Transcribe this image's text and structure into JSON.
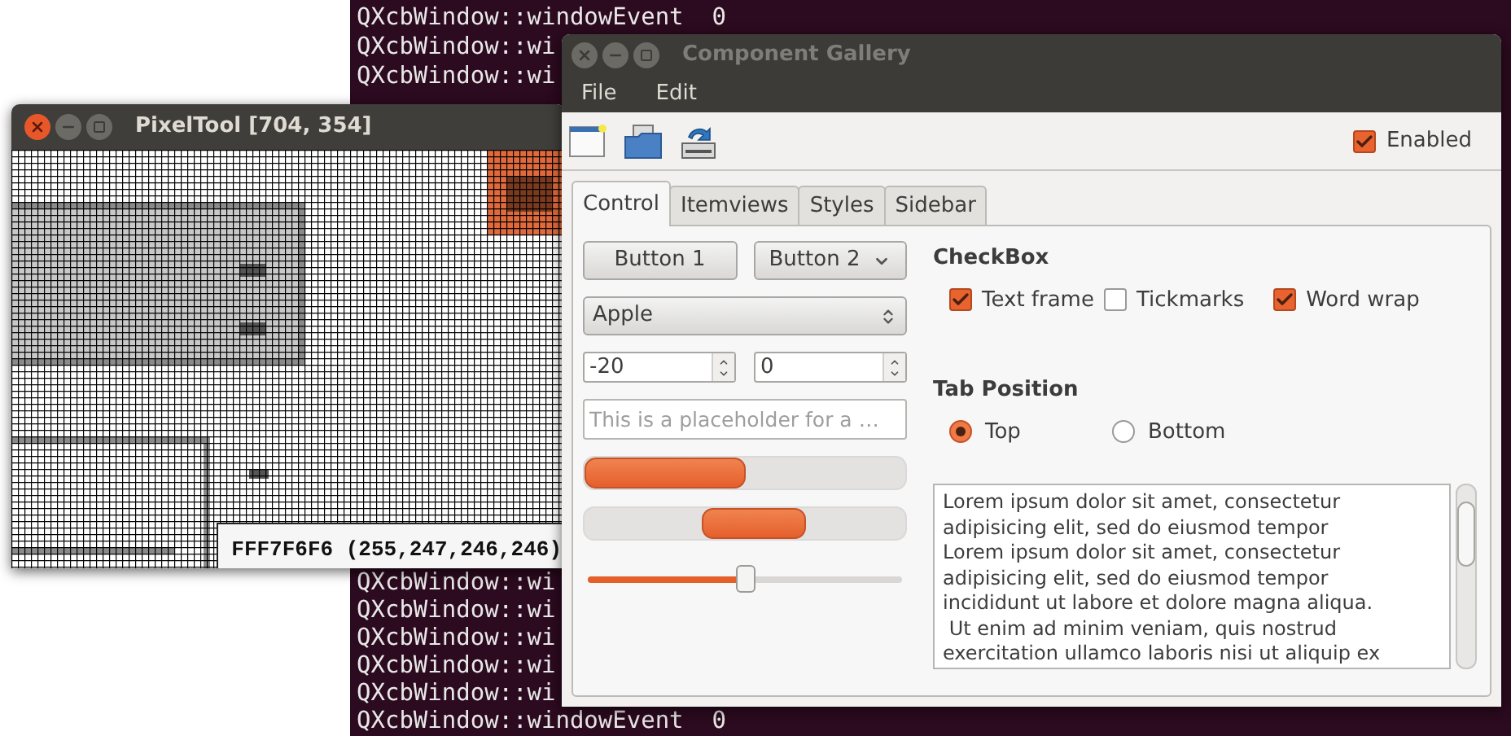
{
  "terminal": {
    "top_lines": [
      "QXcbWindow::windowEvent  0",
      "QXcbWindow::wi",
      "QXcbWindow::wi"
    ],
    "bottom_lines": [
      "QXcbWindow::wi",
      "QXcbWindow::wi",
      "QXcbWindow::wi",
      "QXcbWindow::wi",
      "QXcbWindow::wi",
      "QXcbWindow::windowEvent  0"
    ]
  },
  "pixel_tool": {
    "title": "PixelTool [704, 354]",
    "readout": "FFF7F6F6 (255,247,246,246)"
  },
  "gallery": {
    "title": "Component Gallery",
    "menu": [
      "File",
      "Edit"
    ],
    "enabled": {
      "label": "Enabled",
      "checked": true
    },
    "tabs": [
      {
        "label": "Control",
        "selected": true
      },
      {
        "label": "Itemviews",
        "selected": false
      },
      {
        "label": "Styles",
        "selected": false
      },
      {
        "label": "Sidebar",
        "selected": false
      }
    ],
    "buttons": [
      {
        "label": "Button 1",
        "kind": "plain"
      },
      {
        "label": "Button 2",
        "kind": "menu"
      }
    ],
    "combo": {
      "value": "Apple"
    },
    "spinboxes": [
      {
        "value": "-20"
      },
      {
        "value": "0"
      }
    ],
    "line_edit": {
      "placeholder": "This is a placeholder for a …"
    },
    "progress": {
      "level": 0.5
    },
    "slider": {
      "level": 0.5
    },
    "checkbox_group": {
      "title": "CheckBox",
      "items": [
        {
          "label": "Text frame",
          "checked": true
        },
        {
          "label": "Tickmarks",
          "checked": false
        },
        {
          "label": "Word wrap",
          "checked": true
        }
      ]
    },
    "radio_group": {
      "title": "Tab Position",
      "items": [
        {
          "label": "Top",
          "selected": true
        },
        {
          "label": "Bottom",
          "selected": false
        }
      ]
    },
    "text_edit": {
      "lines": [
        "Lorem ipsum dolor sit amet, consectetur",
        "adipisicing elit, sed do eiusmod tempor",
        "Lorem ipsum dolor sit amet, consectetur",
        "adipisicing elit, sed do eiusmod tempor",
        "incididunt ut labore et dolore magna aliqua.",
        " Ut enim ad minim veniam, quis nostrud",
        "exercitation ullamco laboris nisi ut aliquip ex"
      ]
    }
  }
}
